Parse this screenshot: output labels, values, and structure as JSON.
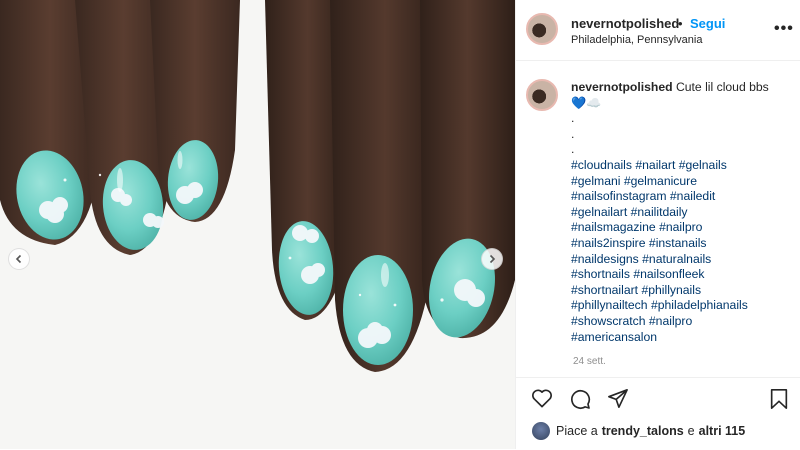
{
  "post": {
    "username": "nevernotpolished",
    "follow_label": "Segui",
    "dot": "•",
    "location": "Philadelphia, Pennsylvania",
    "more_label": "•••"
  },
  "caption": {
    "username": "nevernotpolished",
    "text": "Cute lil cloud bbs",
    "emoji": "💙☁️",
    "dots": [
      ".",
      ".",
      "."
    ],
    "hashtags": [
      "#cloudnails #nailart #gelnails",
      "#gelmani #gelmanicure",
      "#nailsofinstagram #nailedit",
      "#gelnailart #nailitdaily",
      "#nailsmagazine #nailpro",
      "#nails2inspire #instanails",
      "#naildesigns #naturalnails",
      "#shortnails #nailsonfleek",
      "#shortnailart #phillynails",
      "#phillynailtech #philadelphianails",
      "#showscratch #nailpro",
      "#americansalon"
    ],
    "timestamp": "24 sett."
  },
  "likes": {
    "prefix": "Piace a",
    "user": "trendy_talons",
    "conjunction": "e",
    "others": "altri 115"
  },
  "actions": {
    "icons": [
      "heart-icon",
      "comment-icon",
      "share-icon",
      "bookmark-icon"
    ]
  },
  "colors": {
    "follow": "#0095f6",
    "hashtag": "#00376b",
    "nail": "#6ccfc4",
    "skin": "#4a3228"
  }
}
